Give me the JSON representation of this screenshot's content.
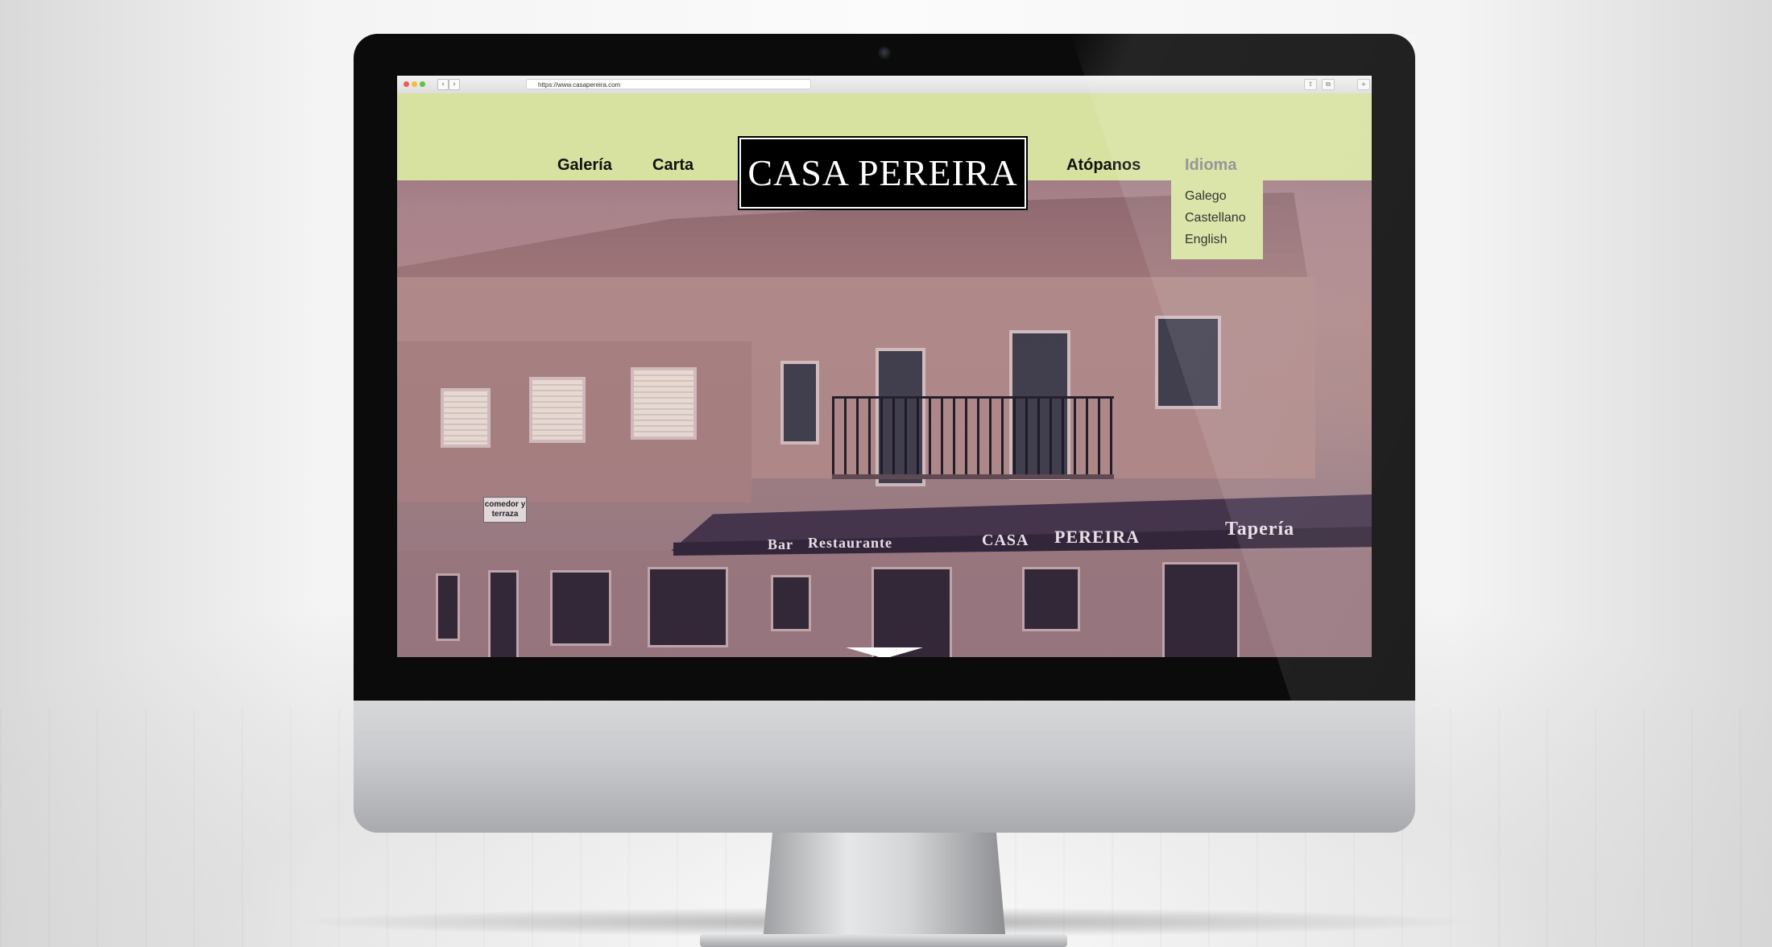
{
  "browser": {
    "url": "https://www.casapereira.com",
    "back_symbol": "‹",
    "forward_symbol": "›"
  },
  "site": {
    "brand": "CASA PEREIRA",
    "nav": {
      "galeria": "Galería",
      "carta": "Carta",
      "atopanos": "Atópanos",
      "idioma": "Idioma"
    },
    "languages": [
      "Galego",
      "Castellano",
      "English"
    ],
    "colors": {
      "header": "#d7e2a0",
      "logo_background": "#000000",
      "idioma_muted": "#8c8c8c"
    }
  },
  "photo_text": {
    "sign": "comedor y terraza",
    "awning_bar": "Bar",
    "awning_restaurante": "Restaurante",
    "awning_casa": "CASA",
    "awning_pereira": "PEREIRA",
    "awning_taperia": "Tapería"
  }
}
